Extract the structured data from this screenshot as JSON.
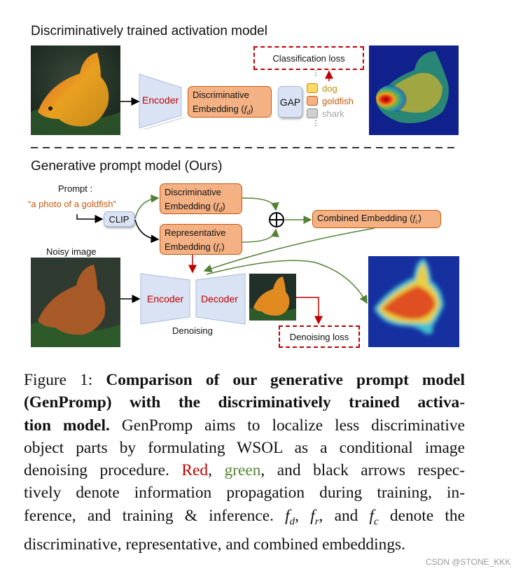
{
  "figure": {
    "top_section": {
      "title": "Discriminatively trained activation model",
      "encoder_label": "Encoder",
      "embedding_line1": "Discriminative",
      "embedding_line2": "Embedding (",
      "embedding_symbol": "f",
      "embedding_sub": "d",
      "embedding_close": ")",
      "gap_label": "GAP",
      "loss_label": "Classification loss",
      "classes": [
        {
          "label": "dog",
          "color": "#ffd966",
          "border": "#bf9000",
          "text_color": "#bf9000"
        },
        {
          "label": "goldfish",
          "color": "#f4b183",
          "border": "#c55a11",
          "text_color": "#c55a11"
        },
        {
          "label": "shark",
          "color": "#d0d0d0",
          "border": "#8c8c8c",
          "text_color": "#a6a6a6"
        }
      ],
      "ellipsis": "⋮"
    },
    "bottom_section": {
      "title": "Generative prompt model (Ours)",
      "prompt_label": "Prompt :",
      "prompt_text": "“a photo of a goldfish”",
      "clip_label": "CLIP",
      "disc_embedding_line1": "Discriminative",
      "disc_embedding_line2": "Embedding (",
      "disc_symbol": "f",
      "disc_sub": "d",
      "rep_embedding_line1": "Representative",
      "rep_embedding_line2": "Embedding (",
      "rep_symbol": "f",
      "rep_sub": "r",
      "close_paren": ")",
      "combined_label": "Combined Embedding (",
      "combined_symbol": "f",
      "combined_sub": "c",
      "plus_symbol": "⊕",
      "noisy_label": "Noisy image",
      "encoder_label": "Encoder",
      "decoder_label": "Decoder",
      "denoising_label": "Denoising",
      "loss_label": "Denoising loss"
    },
    "colors": {
      "training_arrow": "#c00000",
      "inference_arrow": "#548235",
      "both_arrow": "#000000",
      "embedding_fill": "#f4b183",
      "module_fill": "#dae3f3"
    }
  },
  "caption": {
    "lines": [
      {
        "parts": [
          {
            "t": "Figure 1: ",
            "s": "normal"
          },
          {
            "t": "Comparison of our generative prompt model",
            "s": "bold"
          }
        ]
      },
      {
        "parts": [
          {
            "t": "(GenPromp) with the discriminatively trained activa-",
            "s": "bold"
          }
        ]
      },
      {
        "parts": [
          {
            "t": "tion model.",
            "s": "bold"
          },
          {
            "t": " GenPromp aims to localize less discriminative",
            "s": "normal"
          }
        ]
      },
      {
        "parts": [
          {
            "t": "object parts by formulating WSOL as a conditional image",
            "s": "normal"
          }
        ]
      },
      {
        "parts": [
          {
            "t": "denoising procedure. ",
            "s": "normal"
          },
          {
            "t": "Red",
            "s": "red"
          },
          {
            "t": ", ",
            "s": "normal"
          },
          {
            "t": "green",
            "s": "green"
          },
          {
            "t": ", and black arrows respec-",
            "s": "normal"
          }
        ]
      },
      {
        "parts": [
          {
            "t": "tively denote information propagation during training, in-",
            "s": "normal"
          }
        ]
      },
      {
        "parts": [
          {
            "t": "ference, and training & inference. ",
            "s": "normal"
          },
          {
            "t": "f",
            "s": "italic"
          },
          {
            "t": "d",
            "s": "sub"
          },
          {
            "t": ", ",
            "s": "normal"
          },
          {
            "t": "f",
            "s": "italic"
          },
          {
            "t": "r",
            "s": "sub"
          },
          {
            "t": ", and ",
            "s": "normal"
          },
          {
            "t": "f",
            "s": "italic"
          },
          {
            "t": "c",
            "s": "sub"
          },
          {
            "t": " denote the",
            "s": "normal"
          }
        ]
      },
      {
        "parts": [
          {
            "t": "discriminative, representative, and combined embeddings.",
            "s": "normal"
          }
        ]
      }
    ]
  },
  "watermark": "CSDN @STONE_KKK"
}
